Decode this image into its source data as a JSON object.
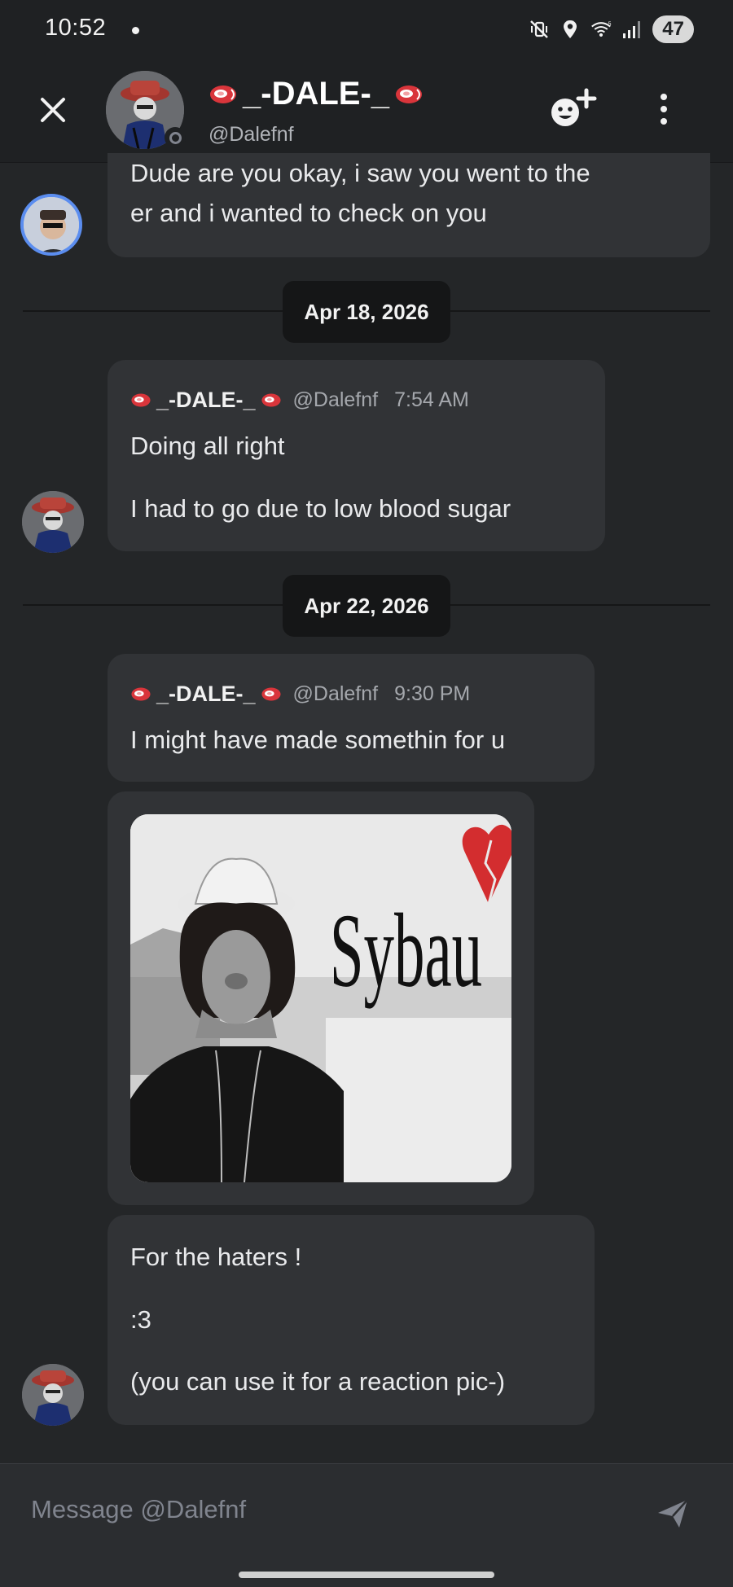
{
  "status_bar": {
    "time": "10:52",
    "battery": "47",
    "icons": [
      "mute-vibrate-icon",
      "location-icon",
      "wifi-icon",
      "signal-icon"
    ]
  },
  "header": {
    "display_name": "_-DALE-_",
    "handle": "@Dalefnf",
    "status": "offline",
    "name_emoji": "steak-emoji"
  },
  "messages": [
    {
      "id": "m0",
      "author": "",
      "lines": [
        "Dude are you okay, i saw you went to the",
        "er and i wanted to check on you"
      ]
    },
    {
      "id": "date1",
      "date": "Apr 18, 2026"
    },
    {
      "id": "m1",
      "author": "_-DALE-_",
      "handle": "@Dalefnf",
      "time": "7:54 AM",
      "lines": [
        "Doing all right",
        "I had to go due to low blood sugar"
      ]
    },
    {
      "id": "date2",
      "date": "Apr 22, 2026"
    },
    {
      "id": "m2",
      "author": "_-DALE-_",
      "handle": "@Dalefnf",
      "time": "9:30 PM",
      "lines": [
        "I might have made somethin for u"
      ]
    },
    {
      "id": "m3",
      "attachment": {
        "type": "image",
        "caption_text": "Sybau"
      }
    },
    {
      "id": "m4",
      "lines": [
        "For the haters !",
        ":3",
        "(you can use it for a reaction pic-)"
      ]
    }
  ],
  "composer": {
    "placeholder": "Message @Dalefnf"
  },
  "colors": {
    "background": "#242628",
    "bubble": "#313336",
    "header": "#1f2123",
    "date_pill": "#151617",
    "muted_text": "#a5a8ad"
  }
}
